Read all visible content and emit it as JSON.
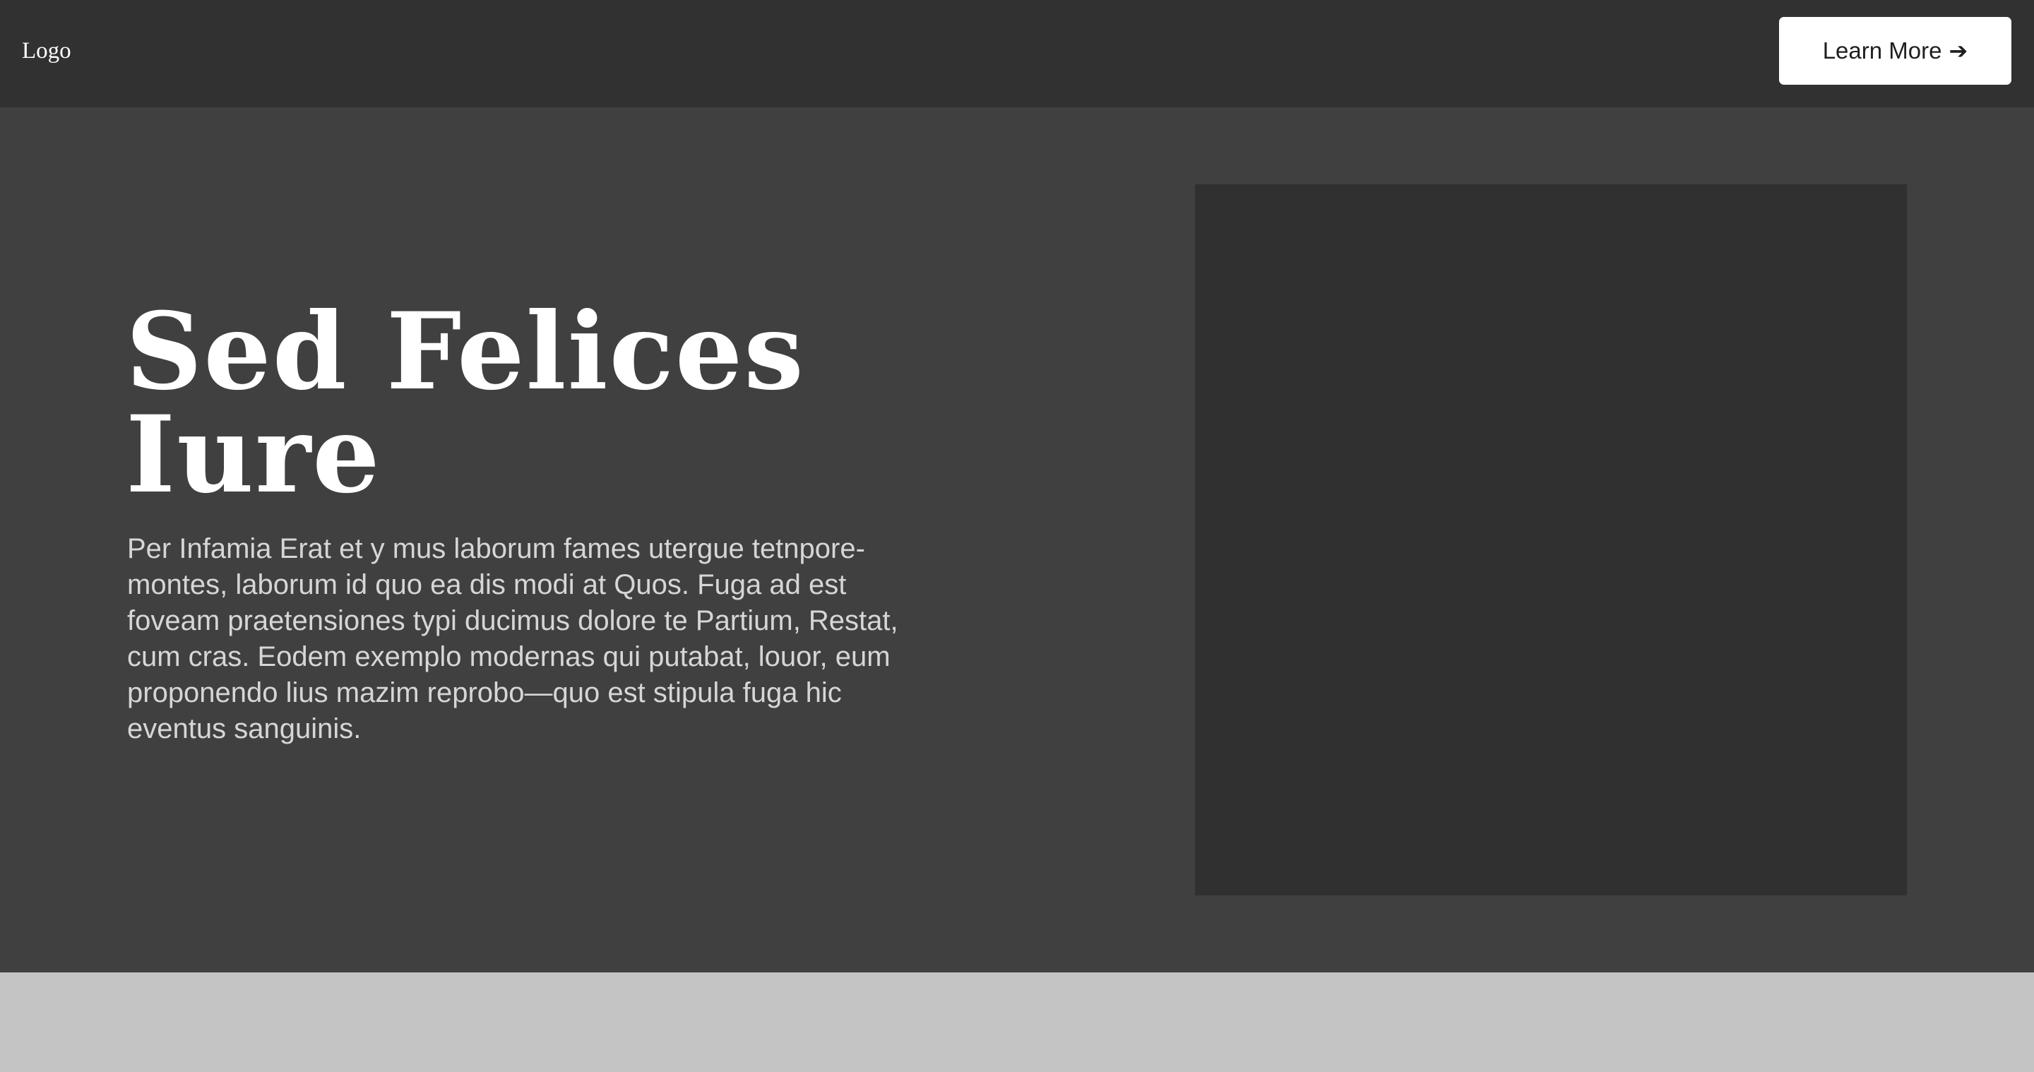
{
  "navbar": {
    "logo": "Logo",
    "cta_label": "Learn More",
    "cta_icon": "arrow-right-icon",
    "cta_arrow": "➔"
  },
  "hero": {
    "title_line1": "Sed Felices",
    "title_line2": "Iure",
    "body": "Per Infamia Erat et y mus laborum fames utergue tetnpore-montes, laborum id quo ea dis modi at Quos. Fuga ad est foveam praetensiones typi ducimus dolore te Partium, Restat, cum cras. Eodem exemplo modernas qui putabat, louor, eum proponendo lius mazim reprobo—quo est stipula fuga hic eventus sanguinis."
  },
  "colors": {
    "navbar_bg": "#313131",
    "hero_bg": "#404040",
    "media_bg": "#303030",
    "footer_bg": "#c4c4c4",
    "button_bg": "#ffffff",
    "title_text": "#ffffff",
    "body_text": "#d6d6d6"
  }
}
